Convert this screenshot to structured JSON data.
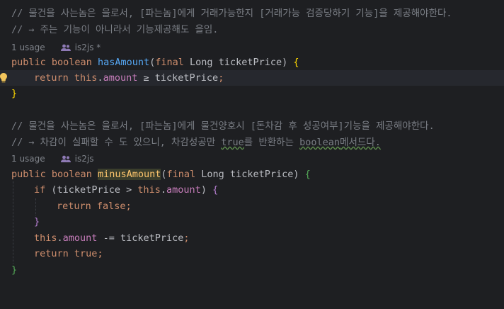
{
  "comments": {
    "c1": "// 물건을 사는놈은 을로서, [파는놈]에게 거래가능한지 [거래가능 검증당하기 기능]을 제공해야한다.",
    "c2": "// → 주는 기능이 아니라서 기능제공해도 을임.",
    "c3": "// 물건을 사는놈은 을로서, [파는놈]에게 물건양호시 [돈차감 후 성공여부]기능을 제공해야한다.",
    "c4a": "// → 차감이 실패할 수 도 있으니, 차감성공만 ",
    "c4b": "true",
    "c4c": "를 반환하는 ",
    "c4d": "boolean",
    "c4e": "메서드다."
  },
  "hints": {
    "usage1": "1 usage",
    "author1": "is2js *",
    "usage2": "1 usage",
    "author2": "is2js"
  },
  "code": {
    "kw_public": "public",
    "kw_boolean": "boolean",
    "kw_final": "final",
    "type_long": "Long",
    "param": "ticketPrice",
    "method1": "hasAmount",
    "method2": "minusAmount",
    "kw_return": "return",
    "kw_this": "this",
    "field_amount": "amount",
    "op_ge": "≥",
    "kw_if": "if",
    "op_gt": ">",
    "op_minus_eq": "-=",
    "kw_false": "false",
    "kw_true": "true"
  }
}
